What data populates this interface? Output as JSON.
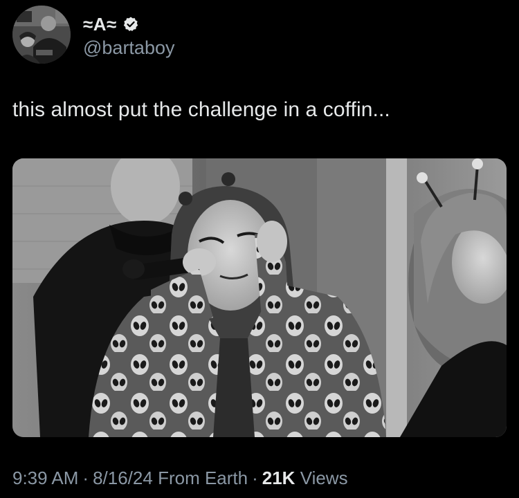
{
  "author": {
    "display_name": "≈A≈",
    "handle": "@bartaboy",
    "verified": true,
    "avatar_icon": "profile-photo"
  },
  "tweet": {
    "text": "this almost put the challenge in a coffin..."
  },
  "meta": {
    "time": "9:39 AM",
    "date": "8/16/24",
    "location": "From Earth",
    "separator": "·",
    "views_count": "21K",
    "views_label": "Views"
  },
  "colors": {
    "background": "#000000",
    "primary_text": "#e7e9ea",
    "secondary_text": "#8b98a5"
  }
}
